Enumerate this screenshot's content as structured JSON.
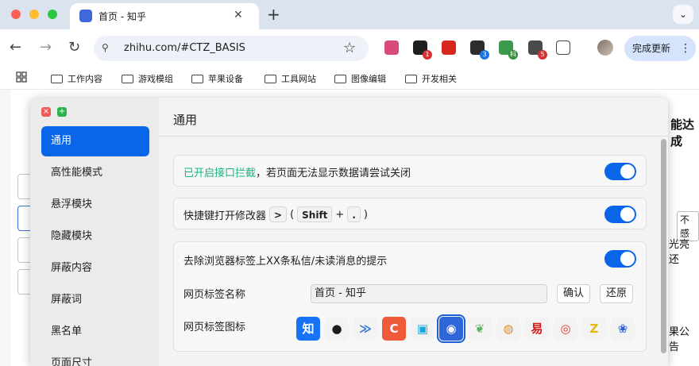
{
  "browser": {
    "tab_title": "首页 - 知乎",
    "tab_close": "✕",
    "new_tab": "+",
    "tab_dropdown": "⌄",
    "back": "←",
    "forward": "→",
    "reload": "↻",
    "site_info": "⚲",
    "url": "zhihu.com/#CTZ_BASIS",
    "star": "☆",
    "update_button": "完成更新",
    "menu_dots": "⋮",
    "extensions": [
      {
        "name": "translate-icon",
        "color": "#d94a7a",
        "badge": "",
        "badge_color": ""
      },
      {
        "name": "chat-extension-icon",
        "color": "#1f1f1f",
        "badge": "1",
        "badge_color": "#d63232"
      },
      {
        "name": "ublock-icon",
        "color": "#d9261c",
        "badge": "",
        "badge_color": ""
      },
      {
        "name": "github-extension-icon",
        "color": "#2c2c2c",
        "badge": "3",
        "badge_color": "#1a73e8"
      },
      {
        "name": "dev-extension-icon",
        "color": "#3d9a4d",
        "badge": "科",
        "badge_color": "#2f8f3a"
      },
      {
        "name": "tampermonkey-icon",
        "color": "#4a4a4a",
        "badge": "5",
        "badge_color": "#d63232"
      },
      {
        "name": "puzzle-icon",
        "color": "#ffffff",
        "badge": "",
        "badge_color": ""
      }
    ]
  },
  "bookmarks": [
    "工作内容",
    "游戏模组",
    "苹果设备",
    "工具网站",
    "图像编辑",
    "开发相关"
  ],
  "background": {
    "right_heading": "能达成",
    "right_button": "不感",
    "right_text1": "光亮还",
    "right_text2": "果公告"
  },
  "panel": {
    "close": "×",
    "add": "+",
    "sidebar": [
      "通用",
      "高性能模式",
      "悬浮模块",
      "隐藏模块",
      "屏蔽内容",
      "屏蔽词",
      "黑名单",
      "页面尺寸"
    ],
    "active_index": 0,
    "title": "通用",
    "row1_highlight": "已开启接口拦截",
    "row1_rest": "，若页面无法显示数据请尝试关闭",
    "row2_prefix": "快捷键打开修改器",
    "row2_key1": ">",
    "row2_open": "(",
    "row2_key2": "Shift",
    "row2_plus": "+",
    "row2_key3": ".",
    "row2_close": ")",
    "row3_label": "去除浏览器标签上XX条私信/未读消息的提示",
    "tab_name_label": "网页标签名称",
    "tab_name_value": "首页 - 知乎",
    "confirm_button": "确认",
    "restore_button": "还原",
    "tab_icon_label": "网页标签图标",
    "icons": [
      {
        "name": "zhihu-icon",
        "glyph": "知",
        "bg": "#1772f6",
        "fg": "#ffffff"
      },
      {
        "name": "github-icon",
        "glyph": "●",
        "bg": "#f3f3f3",
        "fg": "#1b1b1b"
      },
      {
        "name": "chevron-logo-icon",
        "glyph": "≫",
        "bg": "#f3f3f3",
        "fg": "#3277d8"
      },
      {
        "name": "c-logo-icon",
        "glyph": "C",
        "bg": "#ef5b3a",
        "fg": "#ffffff"
      },
      {
        "name": "bilibili-icon",
        "glyph": "▣",
        "bg": "#f3f3f3",
        "fg": "#15a8e0"
      },
      {
        "name": "monster-icon",
        "glyph": "◉",
        "bg": "#2f67d8",
        "fg": "#ffffff"
      },
      {
        "name": "leaf-icon",
        "glyph": "❦",
        "bg": "#f3f3f3",
        "fg": "#5bb35e"
      },
      {
        "name": "qq-icon",
        "glyph": "◍",
        "bg": "#f3f3f3",
        "fg": "#e98a1d"
      },
      {
        "name": "netease-icon",
        "glyph": "易",
        "bg": "#f3f3f3",
        "fg": "#d51818"
      },
      {
        "name": "weibo-icon",
        "glyph": "◎",
        "bg": "#f3f3f3",
        "fg": "#e0332a"
      },
      {
        "name": "z-logo-icon",
        "glyph": "Z",
        "bg": "#f3f3f3",
        "fg": "#e8b70d"
      },
      {
        "name": "baidu-icon",
        "glyph": "❀",
        "bg": "#f3f3f3",
        "fg": "#2f5fd8"
      }
    ]
  }
}
